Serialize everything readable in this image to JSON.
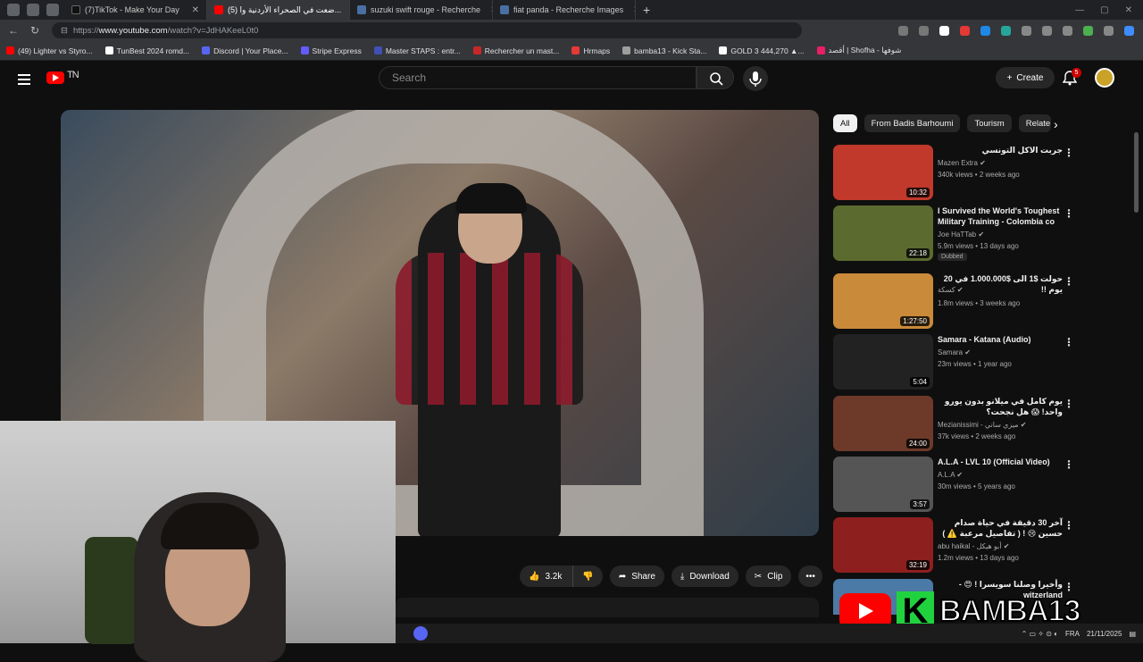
{
  "tabs": [
    {
      "label": "(7)TikTok - Make Your Day",
      "color": "#000000",
      "active": false
    },
    {
      "label": "(5) ضعت في الصحراء الأردنية وا...",
      "color": "#ff0000",
      "active": true
    },
    {
      "label": "suzuki swift rouge - Recherche",
      "color": "#4a6fa5",
      "active": false
    },
    {
      "label": "fiat panda - Recherche Images",
      "color": "#4a6fa5",
      "active": false
    }
  ],
  "address": {
    "prefix": "https://",
    "host": "www.youtube.com",
    "path": "/watch?v=JdHAKeeL0t0"
  },
  "bookmarks": [
    {
      "label": "(49) Lighter vs Styro...",
      "color": "#ff0000"
    },
    {
      "label": "TunBest 2024 romd...",
      "color": "#ffffff"
    },
    {
      "label": "Discord | Your Place...",
      "color": "#5865f2"
    },
    {
      "label": "Stripe Express",
      "color": "#635bff"
    },
    {
      "label": "Master STAPS : entr...",
      "color": "#3f51b5"
    },
    {
      "label": "Rechercher un mast...",
      "color": "#c62828"
    },
    {
      "label": "Hrmaps",
      "color": "#e53935"
    },
    {
      "label": "bamba13 - Kick Sta...",
      "color": "#9e9e9e"
    },
    {
      "label": "GOLD 3 444,270 ▲...",
      "color": "#fafafa"
    },
    {
      "label": "أقصد | Shofha - شوفها",
      "color": "#e91e63"
    }
  ],
  "yt": {
    "logo_text": "TN",
    "search_placeholder": "Search",
    "create_label": "Create",
    "notif_count": "5"
  },
  "actions": {
    "likes": "3.2k",
    "share": "Share",
    "download": "Download",
    "clip": "Clip"
  },
  "chips": [
    "All",
    "From Badis Barhoumi",
    "Tourism",
    "Relate"
  ],
  "recommendations": [
    {
      "title": "جربت الاكل التونسي",
      "channel": "Mazen Extra ✔",
      "meta": "340k views • 2 weeks ago",
      "duration": "10:32",
      "thumb": "#c0392b"
    },
    {
      "title": "I Survived the World's Toughest Military Training - Colombia co",
      "channel": "Joe HaTTab ✔",
      "meta": "5.9m views • 13 days ago",
      "duration": "22:18",
      "thumb": "#5b6b2f",
      "badge": "Dubbed"
    },
    {
      "title": "حولت $1 الى $1.000.000 في 20 يوم !!",
      "channel": "كسكة ✔",
      "meta": "1.8m views • 3 weeks ago",
      "duration": "1:27:50",
      "thumb": "#c98a3a"
    },
    {
      "title": "Samara - Katana (Audio)",
      "channel": "Samara ✔",
      "meta": "23m views • 1 year ago",
      "duration": "5:04",
      "thumb": "#222222"
    },
    {
      "title": "يوم كامل في ميلانو بدون يورو واحد! 😱 هل نجحت؟",
      "channel": "Mezianissimi - ميزي ساني ✔",
      "meta": "37k views • 2 weeks ago",
      "duration": "24:00",
      "thumb": "#6d3a2a"
    },
    {
      "title": "A.L.A - LVL 10 (Official Video)",
      "channel": "A.L.A ✔",
      "meta": "30m views • 5 years ago",
      "duration": "3:57",
      "thumb": "#555555"
    },
    {
      "title": "آخر 30 دقيقة في حياة صدام حسين 😢 ! ( تفاصيل مرعبة ⚠️ )",
      "channel": "abu haikal - أبو هيكل ✔",
      "meta": "1.2m views • 13 days ago",
      "duration": "32:19",
      "thumb": "#8e1f1f"
    },
    {
      "title": "وأخيرا وصلنا سويسرا ! 😍 - witzerland",
      "channel": "",
      "meta": "",
      "duration": "",
      "thumb": "#4a7aa5"
    }
  ],
  "overlay": {
    "letter": "K",
    "name": "BAMBA13"
  },
  "taskbar": {
    "lang": "FRA",
    "date": "21/11/2025"
  }
}
